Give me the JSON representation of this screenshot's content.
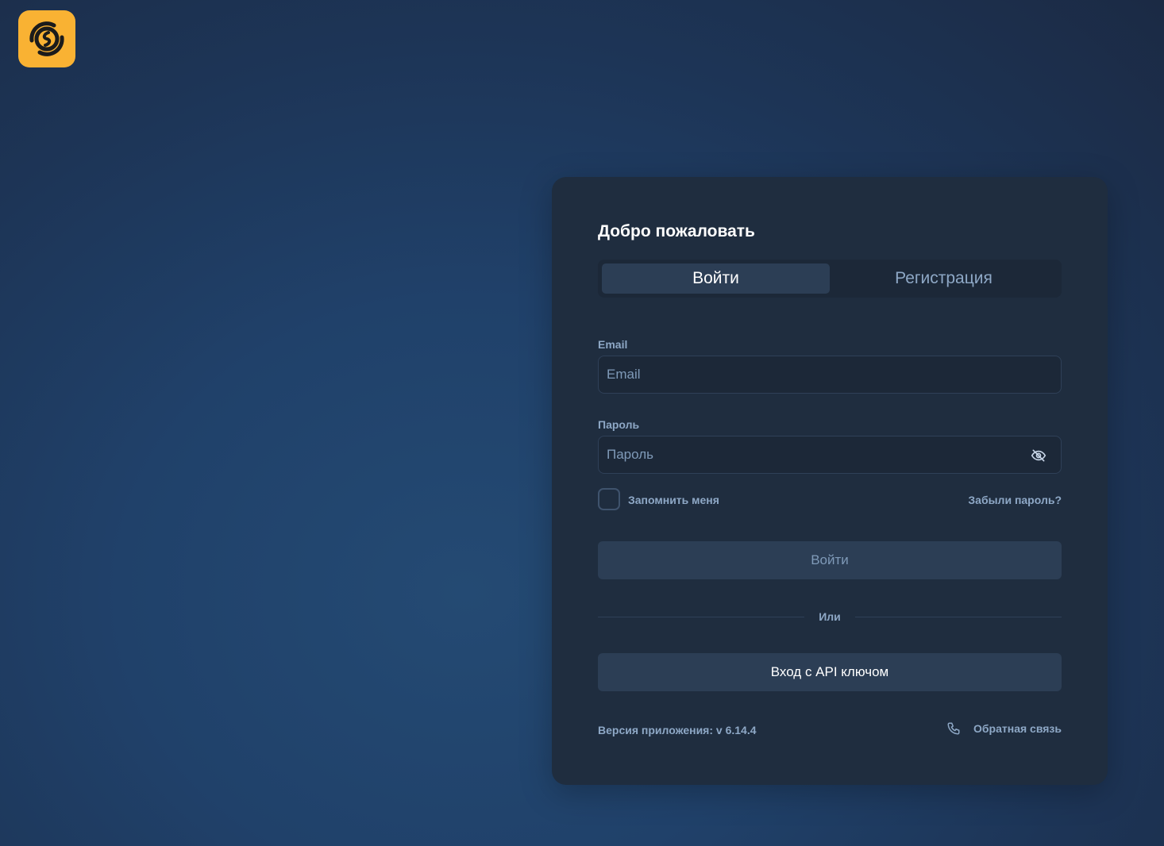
{
  "app": {
    "logo_icon": "swirl-logo-icon",
    "accent_color": "#f9b233"
  },
  "card": {
    "title": "Добро пожаловать",
    "tabs": [
      {
        "label": "Войти",
        "active": true
      },
      {
        "label": "Регистрация",
        "active": false
      }
    ],
    "email": {
      "label": "Email",
      "value": "",
      "placeholder": "Email"
    },
    "password": {
      "label": "Пароль",
      "value": "",
      "placeholder": "Пароль",
      "toggle_icon": "eye-off-icon"
    },
    "remember_label": "Запомнить меня",
    "remember_checked": false,
    "forgot_label": "Забыли пароль?",
    "login_button": "Войти",
    "divider_text": "Или",
    "api_button": "Вход с API ключом",
    "version_text": "Версия приложения: v 6.14.4",
    "feedback_label": "Обратная связь",
    "feedback_icon": "phone-icon"
  }
}
